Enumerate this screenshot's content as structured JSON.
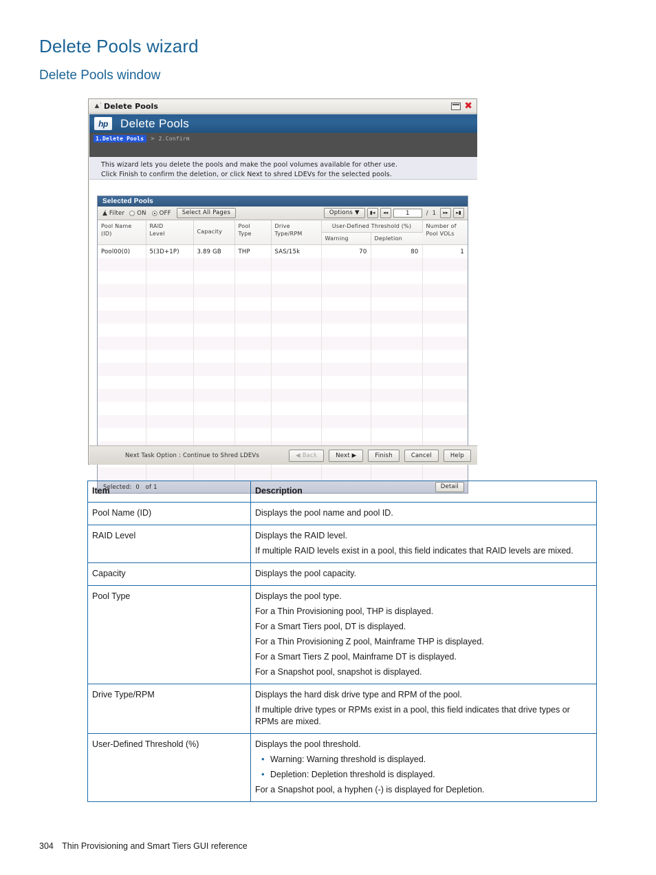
{
  "page": {
    "title": "Delete Pools wizard",
    "subtitle": "Delete Pools window",
    "footer_page_number": "304",
    "footer_text": "Thin Provisioning and Smart Tiers GUI reference"
  },
  "colors": {
    "heading_blue": "#1a6496",
    "table_border_blue": "#1d6aa6",
    "banner_blue": "#2d6395",
    "crumb_active_blue": "#2457d6",
    "close_red": "#d8202a",
    "row_alt": "#faf5f8"
  },
  "window": {
    "titlebar": {
      "chevron_icon": "double-chevron-up-icon",
      "title": "Delete Pools",
      "maximize_icon": "maximize-icon",
      "close_icon": "close-icon"
    },
    "banner": {
      "logo_text": "hp",
      "title": "Delete Pools"
    },
    "breadcrumbs": {
      "active": "1.Delete Pools",
      "separator": ">",
      "inactive": "2.Confirm"
    },
    "instructions": [
      "This wizard lets you delete the pools and make the pool volumes available for other use.",
      "Click Finish to confirm the deletion, or click Next to shred LDEVs for the selected pools."
    ]
  },
  "panel": {
    "title": "Selected Pools",
    "toolbar": {
      "collapse_icon": "double-chevron-up-icon",
      "filter_label": "Filter",
      "filter_on_label": "ON",
      "filter_off_label": "OFF",
      "filter_selected": "OFF",
      "select_all_pages_label": "Select All Pages",
      "options_label": "Options",
      "options_caret": "▼",
      "page_first_icon": "page-first-icon",
      "page_prev_icon": "page-prev-icon",
      "page_value": "1",
      "page_separator": "/",
      "page_total": "1",
      "page_next_icon": "page-next-icon",
      "page_last_icon": "page-last-icon"
    },
    "table": {
      "group_header": "User-Defined Threshold (%)",
      "headers": [
        "Pool Name\n(ID)",
        "RAID\nLevel",
        "Capacity",
        "Pool\nType",
        "Drive\nType/RPM",
        "Warning",
        "Depletion",
        "Number of\nPool VOLs"
      ],
      "header_lines": {
        "pool_name": [
          "Pool Name",
          "(ID)"
        ],
        "raid_level": [
          "RAID",
          "Level"
        ],
        "capacity": [
          "Capacity"
        ],
        "pool_type": [
          "Pool",
          "Type"
        ],
        "drive_type": [
          "Drive",
          "Type/RPM"
        ],
        "warning": [
          "Warning"
        ],
        "depletion": [
          "Depletion"
        ],
        "pool_vols": [
          "Number of",
          "Pool VOLs"
        ]
      },
      "rows": [
        {
          "pool_name": "Pool00(0)",
          "raid_level": "5(3D+1P)",
          "capacity": "3.89 GB",
          "pool_type": "THP",
          "drive_type": "SAS/15k",
          "warning": "70",
          "depletion": "80",
          "pool_vols": "1"
        }
      ],
      "empty_row_count": 17
    },
    "footer": {
      "selected_label": "Selected:",
      "selected_count": "0",
      "of_label": "of",
      "total_count": "1",
      "detail_button": "Detail"
    }
  },
  "wizard_bar": {
    "next_task_option": "Next Task Option : Continue to Shred LDEVs",
    "buttons": [
      {
        "label": "Back",
        "icon": "◀",
        "icon_side": "left",
        "disabled": true
      },
      {
        "label": "Next",
        "icon": "▶",
        "icon_side": "right",
        "disabled": false
      },
      {
        "label": "Finish",
        "icon": "",
        "icon_side": "",
        "disabled": false
      },
      {
        "label": "Cancel",
        "icon": "",
        "icon_side": "",
        "disabled": false
      },
      {
        "label": "Help",
        "icon": "",
        "icon_side": "",
        "disabled": false
      }
    ]
  },
  "description_table": {
    "header_item": "Item",
    "header_description": "Description",
    "rows": [
      {
        "item": "Pool Name (ID)",
        "paragraphs": [
          "Displays the pool name and pool ID."
        ],
        "bullets": [],
        "trailing": []
      },
      {
        "item": "RAID Level",
        "paragraphs": [
          "Displays the RAID level.",
          "If multiple RAID levels exist in a pool, this field indicates that RAID levels are mixed."
        ],
        "bullets": [],
        "trailing": []
      },
      {
        "item": "Capacity",
        "paragraphs": [
          "Displays the pool capacity."
        ],
        "bullets": [],
        "trailing": []
      },
      {
        "item": "Pool Type",
        "paragraphs": [
          "Displays the pool type.",
          "For a Thin Provisioning pool, THP is displayed.",
          "For a Smart Tiers pool, DT is displayed.",
          "For a Thin Provisioning Z pool, Mainframe THP is displayed.",
          "For a Smart Tiers Z pool, Mainframe DT is displayed.",
          "For a Snapshot pool, snapshot is displayed."
        ],
        "bullets": [],
        "trailing": []
      },
      {
        "item": "Drive Type/RPM",
        "paragraphs": [
          "Displays the hard disk drive type and RPM of the pool.",
          "If multiple drive types or RPMs exist in a pool, this field indicates that drive types or RPMs are mixed."
        ],
        "bullets": [],
        "trailing": []
      },
      {
        "item": "User-Defined Threshold (%)",
        "paragraphs": [
          "Displays the pool threshold."
        ],
        "bullets": [
          "Warning: Warning threshold is displayed.",
          "Depletion: Depletion threshold is displayed."
        ],
        "trailing": [
          "For a Snapshot pool, a hyphen (-) is displayed for Depletion."
        ]
      }
    ]
  }
}
